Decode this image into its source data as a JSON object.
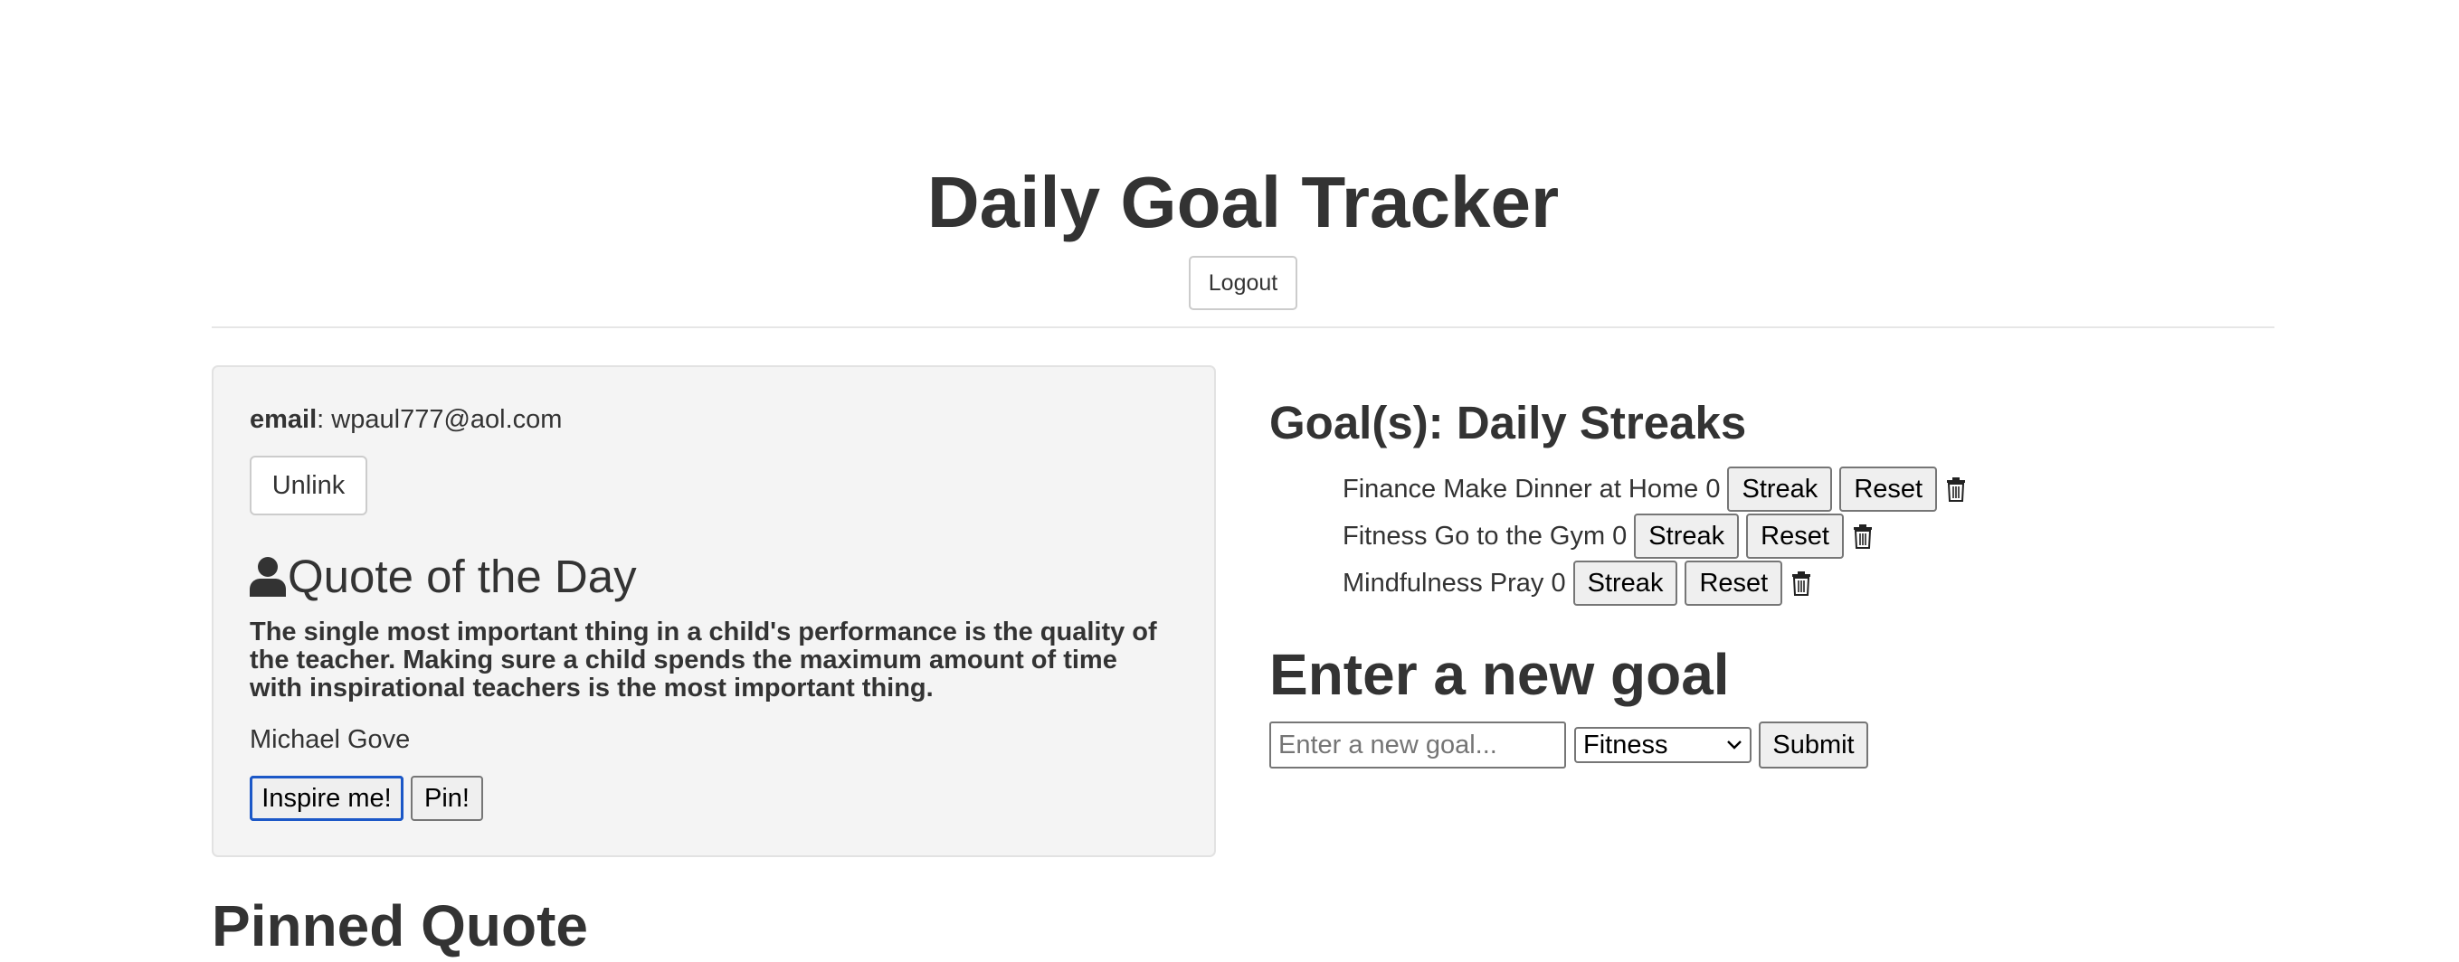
{
  "header": {
    "title": "Daily Goal Tracker",
    "logout_label": "Logout"
  },
  "profile": {
    "email_label": "email",
    "email_value": "wpaul777@aol.com",
    "unlink_label": "Unlink"
  },
  "quote": {
    "heading": "Quote of the Day",
    "icon": "user-icon",
    "text": "The single most important thing in a child's performance is the quality of the teacher. Making sure a child spends the maximum amount of time with inspirational teachers is the most important thing.",
    "author": "Michael Gove",
    "inspire_label": "Inspire me!",
    "pin_label": "Pin!"
  },
  "goals": {
    "heading": "Goal(s): Daily Streaks",
    "items": [
      {
        "text": "Finance Make Dinner at Home 0",
        "streak_label": "Streak",
        "reset_label": "Reset"
      },
      {
        "text": "Fitness Go to the Gym 0",
        "streak_label": "Streak",
        "reset_label": "Reset"
      },
      {
        "text": "Mindfulness Pray 0",
        "streak_label": "Streak",
        "reset_label": "Reset"
      }
    ]
  },
  "new_goal": {
    "heading": "Enter a new goal",
    "placeholder": "Enter a new goal...",
    "category_selected": "Fitness",
    "submit_label": "Submit"
  },
  "pinned": {
    "heading": "Pinned Quote"
  },
  "colors": {
    "focus_outline": "#1c58c7",
    "card_bg": "#f4f4f4",
    "text": "#333333"
  }
}
